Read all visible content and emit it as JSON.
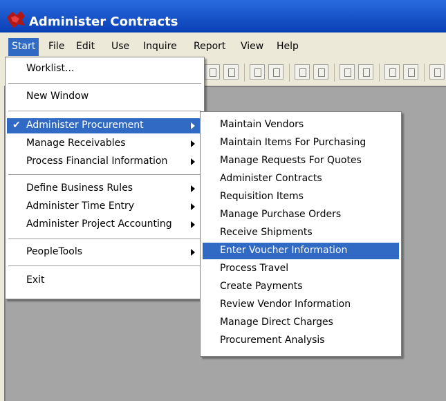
{
  "window": {
    "title": "Administer Contracts"
  },
  "menubar": [
    "Start",
    "File",
    "Edit",
    "Use",
    "Inquire",
    "Report",
    "View",
    "Help"
  ],
  "main_menu": {
    "worklist": "Worklist...",
    "new_window": "New Window",
    "administer_procurement": "Administer Procurement",
    "manage_receivables": "Manage Receivables",
    "process_financial": "Process Financial Information",
    "define_business_rules": "Define Business Rules",
    "administer_time_entry": "Administer Time Entry",
    "administer_project_accounting": "Administer Project Accounting",
    "peopletools": "PeopleTools",
    "exit": "Exit",
    "checkmark": "✔"
  },
  "submenu": [
    "Maintain Vendors",
    "Maintain Items For Purchasing",
    "Manage Requests For Quotes",
    "Administer Contracts",
    "Requisition Items",
    "Manage Purchase Orders",
    "Receive Shipments",
    "Enter Voucher Information",
    "Process Travel",
    "Create Payments",
    "Review Vendor Information",
    "Manage Direct Charges",
    "Procurement Analysis"
  ],
  "colors": {
    "highlight": "#316ac5",
    "title_bar": "#0a3fb4",
    "workspace": "#a5a5a5"
  }
}
